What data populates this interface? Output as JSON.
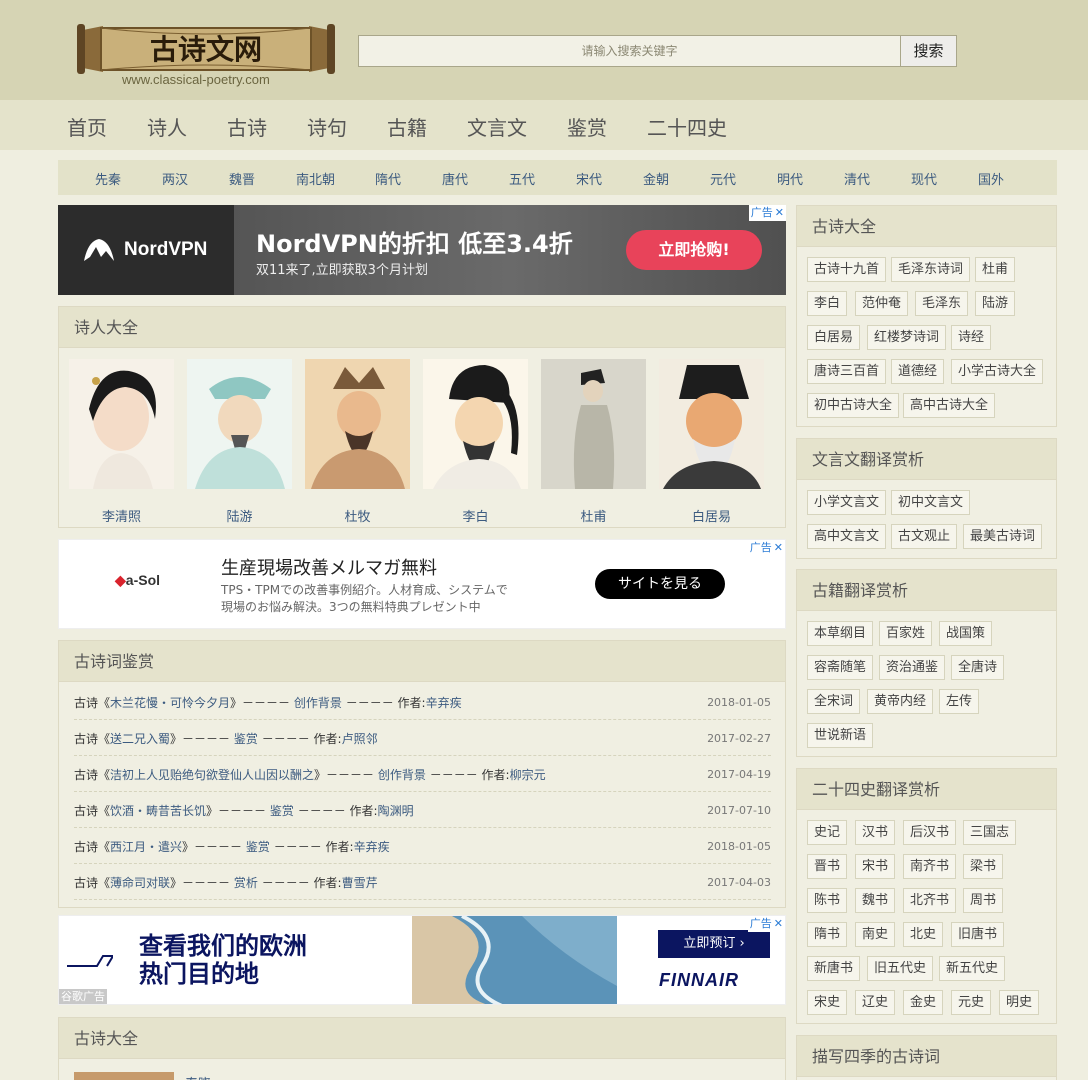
{
  "header": {
    "logo_text": "古诗文网",
    "logo_url": "www.classical-poetry.com",
    "search_placeholder": "请输入搜索关键字",
    "search_button": "搜索"
  },
  "nav": [
    "首页",
    "诗人",
    "古诗",
    "诗句",
    "古籍",
    "文言文",
    "鉴赏",
    "二十四史"
  ],
  "dynasties": [
    "先秦",
    "两汉",
    "魏晋",
    "南北朝",
    "隋代",
    "唐代",
    "五代",
    "宋代",
    "金朝",
    "元代",
    "明代",
    "清代",
    "现代",
    "国外"
  ],
  "ads": {
    "mark": "广告",
    "nordvpn": {
      "brand": "NordVPN",
      "headline": "NordVPN的折扣 低至3.4折",
      "sub": "双11来了,立即获取3个月计划",
      "cta": "立即抢购!"
    },
    "asol": {
      "brand": "a-Sol",
      "headline": "生産現場改善メルマガ無料",
      "desc1": "TPS・TPMでの改善事例紹介。人材育成、システムで",
      "desc2": "現場のお悩み解決。3つの無料特典プレゼント中",
      "cta": "サイトを見る"
    },
    "finnair": {
      "headline1": "查看我们的欧洲",
      "headline2": "热门目的地",
      "cta": "立即预订",
      "brand": "FINNAIR",
      "google_ad": "谷歌广告"
    }
  },
  "poets": {
    "title": "诗人大全",
    "items": [
      {
        "name": "李清照"
      },
      {
        "name": "陆游"
      },
      {
        "name": "杜牧"
      },
      {
        "name": "李白"
      },
      {
        "name": "杜甫"
      },
      {
        "name": "白居易"
      }
    ]
  },
  "appreciation": {
    "title": "古诗词鉴赏",
    "rows": [
      {
        "prefix": "古诗《",
        "poem": "木兰花慢・可怜今夕月",
        "mid": "》－－－－ ",
        "type": "创作背景",
        "sep": " －－－－ 作者:",
        "author": "辛弃疾",
        "date": "2018-01-05"
      },
      {
        "prefix": "古诗《",
        "poem": "送二兄入蜀",
        "mid": "》－－－－ ",
        "type": "鉴赏",
        "sep": " －－－－ 作者:",
        "author": "卢照邻",
        "date": "2017-02-27"
      },
      {
        "prefix": "古诗《",
        "poem": "洁初上人见贻绝句欲登仙人山因以酬之",
        "mid": "》－－－－ ",
        "type": "创作背景",
        "sep": " －－－－ 作者:",
        "author": "柳宗元",
        "date": "2017-04-19"
      },
      {
        "prefix": "古诗《",
        "poem": "饮酒・畴昔苦长饥",
        "mid": "》－－－－ ",
        "type": "鉴赏",
        "sep": " －－－－ 作者:",
        "author": "陶渊明",
        "date": "2017-07-10"
      },
      {
        "prefix": "古诗《",
        "poem": "西江月・遣兴",
        "mid": "》－－－－ ",
        "type": "鉴赏",
        "sep": " －－－－ 作者:",
        "author": "辛弃疾",
        "date": "2018-01-05"
      },
      {
        "prefix": "古诗《",
        "poem": "薄命司对联",
        "mid": "》－－－－ ",
        "type": "赏析",
        "sep": " －－－－ 作者:",
        "author": "曹雪芹",
        "date": "2017-04-03"
      }
    ]
  },
  "bottom_panel": {
    "title": "古诗大全",
    "partial": "春晓"
  },
  "sidebar": {
    "gushi": {
      "title": "古诗大全",
      "tags": [
        "古诗十九首",
        "毛泽东诗词",
        "杜甫",
        "李白",
        "范仲奄",
        "毛泽东",
        "陆游",
        "白居易",
        "红楼梦诗词",
        "诗经",
        "唐诗三百首",
        "道德经",
        "小学古诗大全",
        "初中古诗大全",
        "高中古诗大全"
      ]
    },
    "wenyan": {
      "title": "文言文翻译赏析",
      "tags": [
        "小学文言文",
        "初中文言文",
        "高中文言文",
        "古文观止",
        "最美古诗词"
      ]
    },
    "guji": {
      "title": "古籍翻译赏析",
      "tags": [
        "本草纲目",
        "百家姓",
        "战国策",
        "容斋随笔",
        "资治通鉴",
        "全唐诗",
        "全宋词",
        "黄帝内经",
        "左传",
        "世说新语"
      ]
    },
    "shishi": {
      "title": "二十四史翻译赏析",
      "tags": [
        "史记",
        "汉书",
        "后汉书",
        "三国志",
        "晋书",
        "宋书",
        "南齐书",
        "梁书",
        "陈书",
        "魏书",
        "北齐书",
        "周书",
        "隋书",
        "南史",
        "北史",
        "旧唐书",
        "新唐书",
        "旧五代史",
        "新五代史",
        "宋史",
        "辽史",
        "金史",
        "元史",
        "明史"
      ]
    },
    "seasons": {
      "title": "描写四季的古诗词"
    }
  },
  "colors": {
    "header_bg": "#d6d4b4",
    "nav_bg": "#e4e3cb",
    "page_bg": "#efeee0",
    "link": "#3c5b80"
  }
}
